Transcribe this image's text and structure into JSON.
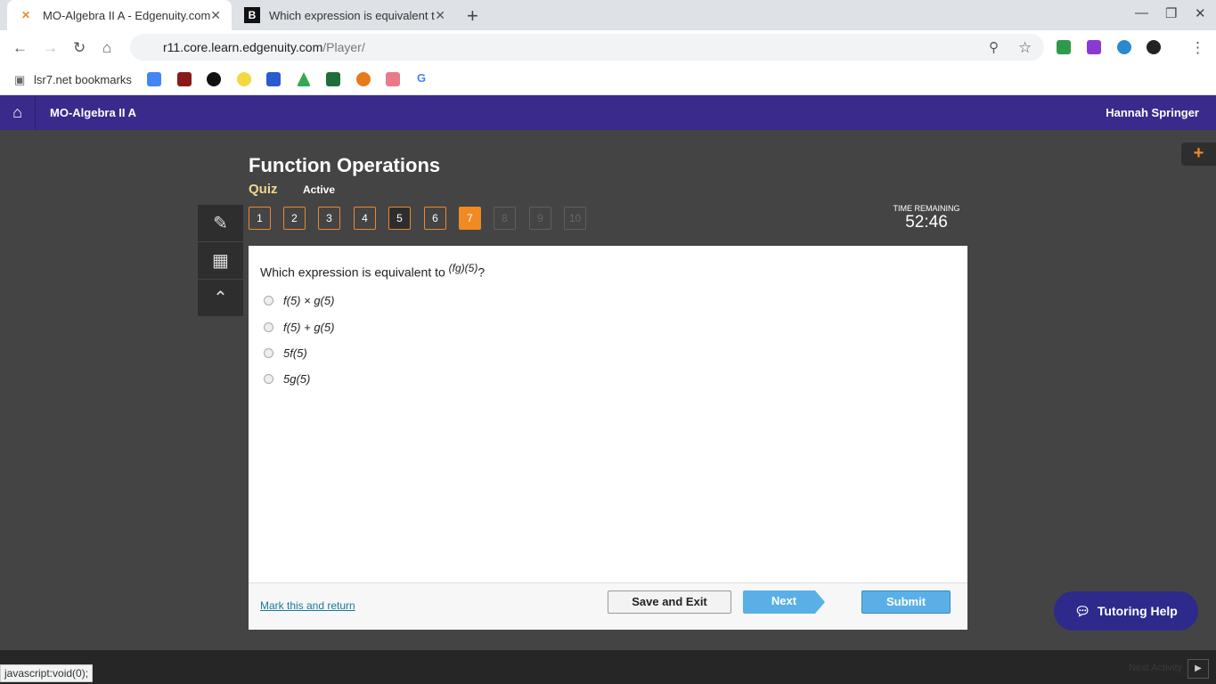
{
  "browser": {
    "tabs": [
      {
        "title": "MO-Algebra II A - Edgenuity.com",
        "active": true
      },
      {
        "title": "Which expression is equivalent to",
        "active": false
      }
    ],
    "url_host": "r11.core.learn.edgenuity.com",
    "url_path": "/Player/",
    "bookmarks_label": "lsr7.net bookmarks",
    "status_url": "javascript:void(0);"
  },
  "header": {
    "course": "MO-Algebra II A",
    "user": "Hannah Springer"
  },
  "quiz": {
    "title": "Function Operations",
    "type": "Quiz",
    "status": "Active",
    "questions": [
      "1",
      "2",
      "3",
      "4",
      "5",
      "6",
      "7",
      "8",
      "9",
      "10"
    ],
    "current": "7",
    "time_label": "TIME REMAINING",
    "time": "52:46"
  },
  "question": {
    "text": "Which expression is equivalent to ",
    "expr": "(fg)(5)",
    "end": "?",
    "options": [
      "f(5) × g(5)",
      "f(5) + g(5)",
      "5f(5)",
      "5g(5)"
    ]
  },
  "footer": {
    "mark": "Mark this and return",
    "save": "Save and Exit",
    "next": "Next",
    "submit": "Submit"
  },
  "tutoring": "Tutoring Help",
  "bottom": {
    "next_activity": "Next Activity"
  },
  "colors": {
    "brand": "#3a2a8c",
    "accent": "#f28a22",
    "button": "#5ab0e6"
  }
}
